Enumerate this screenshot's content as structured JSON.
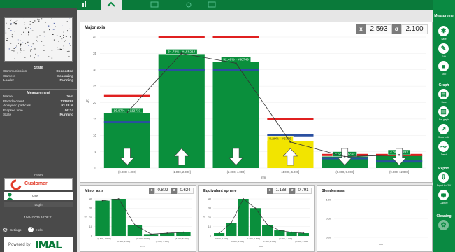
{
  "left_panel": {
    "state_heading": "State",
    "state_items": [
      {
        "label": "Communication",
        "value": "Connected"
      },
      {
        "label": "Camera",
        "value": "Measuring"
      },
      {
        "label": "Loader",
        "value": "Running"
      }
    ],
    "measurement_heading": "Measurement",
    "measurement_items": [
      {
        "label": "Name",
        "value": "Test"
      },
      {
        "label": "Particle count",
        "value": "1336768"
      },
      {
        "label": "Analysed particles",
        "value": "93.28 %"
      },
      {
        "label": "Elapsed time",
        "value": "06:24"
      },
      {
        "label": "State",
        "value": "Running"
      }
    ],
    "reset_label": "Reset",
    "customer_label": "Customer",
    "user_label": "User",
    "login_label": "Login",
    "datetime": "10/04/2025 10:08:21",
    "settings_label": "Settings",
    "help_label": "Help",
    "powered_by": "Powered by",
    "brand": "IMAL"
  },
  "right_panel": {
    "measurement_heading": "Measureme",
    "measurement_buttons": [
      "Save",
      "Edit",
      "Stop"
    ],
    "graph_heading": "Graph",
    "graph_buttons": [
      "Data",
      "Bar graph",
      "Show limits",
      "Trend"
    ],
    "export_heading": "Export",
    "export_buttons": [
      "Export to CSV",
      "Capture"
    ],
    "cleaning_heading": "Cleaning"
  },
  "colors": {
    "brand_green": "#0a8a42",
    "bar_green": "#0a8f3c",
    "bar_yellow": "#f2e400",
    "limit_red": "#e02020",
    "limit_blue": "#2a4fa0"
  },
  "main_chart": {
    "title": "Major axis",
    "stat_x_label": "x",
    "stat_x": "2.593",
    "stat_s_label": "σ",
    "stat_s": "2.100",
    "ylabel": "%",
    "xlabel": "mm",
    "chart_data": {
      "type": "bar",
      "categories": [
        "(0.000, 1.000]",
        "(1.000, 2.000]",
        "(2.000, 4.000]",
        "(4.000, 6.000]",
        "(6.000, 9.000]",
        "(9.000, 12.000]"
      ],
      "values": [
        16.87,
        34.78,
        32.46,
        8.29,
        3.52,
        4.06
      ],
      "bar_labels": [
        "16.87% - #112733",
        "34.78% - #156214",
        "32.46% - #38749",
        "8.29% - #2756",
        "3.52% - #732",
        "4.06% - #82"
      ],
      "bar_colors": [
        "green",
        "green",
        "green",
        "yellow",
        "green",
        "green"
      ],
      "arrows": [
        "down",
        "up",
        "down",
        "up",
        "down",
        "down"
      ],
      "upper_limits": [
        22,
        40,
        40,
        15,
        4,
        4
      ],
      "lower_limits": [
        14,
        30,
        30,
        10,
        3,
        2
      ],
      "trend": [
        17,
        35,
        32,
        8,
        3.5,
        4
      ],
      "yticks": [
        0,
        5,
        10,
        15,
        20,
        25,
        30,
        35,
        40
      ],
      "ylim": [
        0,
        40
      ]
    }
  },
  "minor_chart": {
    "title": "Minor axis",
    "stat_x": "0.802",
    "stat_s": "0.624",
    "ylabel": "%",
    "xlabel": "mm",
    "chart_data": {
      "type": "bar",
      "values": [
        38,
        40,
        12,
        2,
        3,
        4
      ],
      "trend": [
        38,
        40,
        12,
        2,
        3,
        4
      ],
      "yticks": [
        0,
        10,
        20,
        30,
        40
      ],
      "ylim": [
        0,
        40
      ],
      "tick_labels": [
        "(0.500, 0.500]",
        "(0.500, 1.000]",
        "(1.000, 2.000]",
        "(2.000, 3.000]",
        "(3.000, 5.000]"
      ]
    }
  },
  "equiv_chart": {
    "title": "Equivalent sphere",
    "stat_x": "1.138",
    "stat_s": "0.791",
    "ylabel": "%",
    "xlabel": "mm",
    "chart_data": {
      "type": "bar",
      "values": [
        3,
        14,
        40,
        30,
        12,
        6,
        4,
        3
      ],
      "trend": [
        3,
        14,
        40,
        30,
        12,
        6,
        4,
        3
      ],
      "yticks": [
        0,
        10,
        20,
        30,
        40
      ],
      "ylim": [
        0,
        40
      ],
      "tick_labels": [
        "(0.100, 0.500]",
        "(0.500, 1.000]",
        "(1.000, 1.500]",
        "(1.500, 2.000]",
        "(2.000, 3.000]",
        "(3.000, 5.000]"
      ]
    }
  },
  "slender_chart": {
    "title": "Slenderness",
    "xlabel": "mm",
    "yticks": [
      "1.00",
      "0.50",
      "0.00"
    ]
  }
}
